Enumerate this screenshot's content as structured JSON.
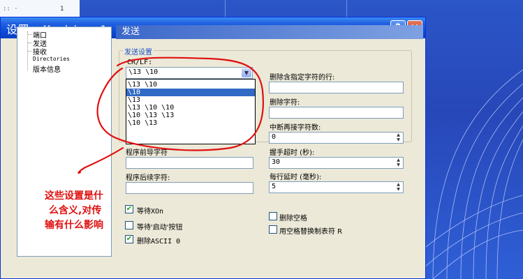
{
  "desktop": {
    "fragment_text": "::    ·",
    "fragment_num": "1"
  },
  "window": {
    "title": "设置: Machine 1",
    "help_label": "?",
    "close_label": "✕"
  },
  "tree": {
    "items": [
      {
        "label": "端口",
        "mono": false
      },
      {
        "label": "发送",
        "mono": false
      },
      {
        "label": "接收",
        "mono": false
      },
      {
        "label": "Directories",
        "mono": true
      },
      {
        "label": "版本信息",
        "mono": false
      }
    ]
  },
  "panel": {
    "header": "发送",
    "group_label": "发送设置",
    "crlf_label": "CR/LF:",
    "crlf_value": "\\13 \\10",
    "crlf_options": [
      "\\13 \\10",
      "\\10",
      "\\13",
      "\\13 \\10 \\10",
      "\\10 \\13 \\13",
      "\\10 \\13"
    ],
    "crlf_selected_index": 1,
    "prefix_label": "程序前导字符",
    "suffix_label": "程序后续字符:",
    "delete_contains_label": "删除含指定字符的行:",
    "delete_chars_label": "删除字符:",
    "interrupt_label": "中断再接字符数:",
    "interrupt_value": "0",
    "handshake_label": "握手超时 (秒):",
    "handshake_value": "30",
    "line_delay_label": "每行延时 (毫秒):",
    "line_delay_value": "5",
    "checkboxes": [
      {
        "label": "等待XOn",
        "checked": true
      },
      {
        "label": "等待'启动'按钮",
        "checked": false
      },
      {
        "label": "删除ASCII 0",
        "checked": true
      },
      {
        "label": "删除空格",
        "checked": false
      },
      {
        "label": "用空格替换制表符 R",
        "checked": false
      }
    ]
  },
  "annotation": {
    "line1": "这些设置是什",
    "line2": "么含义,对传",
    "line3": "输有什么影响",
    "color": "#e01010"
  }
}
